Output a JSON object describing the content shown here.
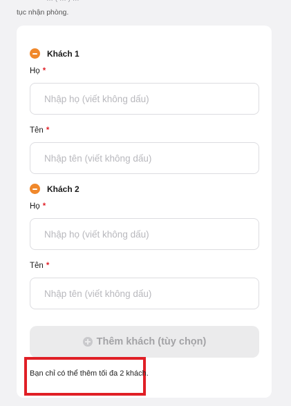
{
  "top": {
    "clipped_text": "… ( … ) …",
    "note": "tục nhận phòng."
  },
  "guests": [
    {
      "title": "Khách 1",
      "last_name_label": "Họ",
      "last_name_placeholder": "Nhập họ (viết không dấu)",
      "first_name_label": "Tên",
      "first_name_placeholder": "Nhập tên (viết không dấu)"
    },
    {
      "title": "Khách 2",
      "last_name_label": "Họ",
      "last_name_placeholder": "Nhập họ (viết không dấu)",
      "first_name_label": "Tên",
      "first_name_placeholder": "Nhập tên (viết không dấu)"
    }
  ],
  "required_mark": "*",
  "add_guest": {
    "label": "Thêm khách (tùy chọn)",
    "icon": "plus-circle-icon"
  },
  "limit_message": "Bạn chỉ có thể thêm tối đa 2 khách.",
  "colors": {
    "accent": "#f0882b",
    "required": "#e0222a",
    "highlight": "#e01f26"
  }
}
